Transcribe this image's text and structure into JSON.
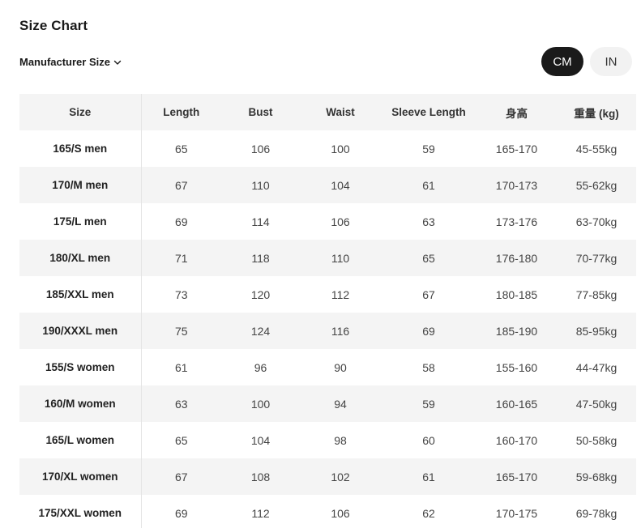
{
  "title": "Size Chart",
  "size_selector": {
    "label": "Manufacturer Size",
    "icon": "chevron-down-icon"
  },
  "units": {
    "options": [
      "CM",
      "IN"
    ],
    "selected": "CM"
  },
  "colors": {
    "active_unit_bg": "#1a1a1a",
    "inactive_unit_bg": "#f2f2f2",
    "row_shade": "#f4f4f4"
  },
  "table": {
    "headers": [
      "Size",
      "Length",
      "Bust",
      "Waist",
      "Sleeve Length",
      "身高",
      "重量 (kg)"
    ],
    "rows": [
      [
        "165/S men",
        "65",
        "106",
        "100",
        "59",
        "165-170",
        "45-55kg"
      ],
      [
        "170/M men",
        "67",
        "110",
        "104",
        "61",
        "170-173",
        "55-62kg"
      ],
      [
        "175/L men",
        "69",
        "114",
        "106",
        "63",
        "173-176",
        "63-70kg"
      ],
      [
        "180/XL men",
        "71",
        "118",
        "110",
        "65",
        "176-180",
        "70-77kg"
      ],
      [
        "185/XXL men",
        "73",
        "120",
        "112",
        "67",
        "180-185",
        "77-85kg"
      ],
      [
        "190/XXXL men",
        "75",
        "124",
        "116",
        "69",
        "185-190",
        "85-95kg"
      ],
      [
        "155/S women",
        "61",
        "96",
        "90",
        "58",
        "155-160",
        "44-47kg"
      ],
      [
        "160/M women",
        "63",
        "100",
        "94",
        "59",
        "160-165",
        "47-50kg"
      ],
      [
        "165/L women",
        "65",
        "104",
        "98",
        "60",
        "160-170",
        "50-58kg"
      ],
      [
        "170/XL women",
        "67",
        "108",
        "102",
        "61",
        "165-170",
        "59-68kg"
      ],
      [
        "175/XXL women",
        "69",
        "112",
        "106",
        "62",
        "170-175",
        "69-78kg"
      ]
    ]
  }
}
